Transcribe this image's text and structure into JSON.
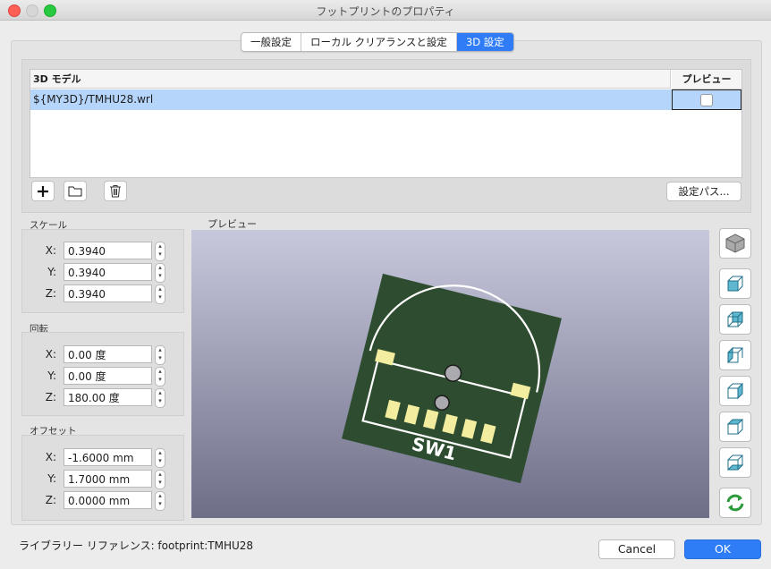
{
  "window": {
    "title": "フットプリントのプロパティ"
  },
  "tabs": [
    {
      "label": "一般設定"
    },
    {
      "label": "ローカル クリアランスと設定"
    },
    {
      "label": "3D 設定"
    }
  ],
  "models": {
    "col_model": "3D モデル",
    "col_preview": "プレビュー",
    "rows": [
      {
        "path": "${MY3D}/TMHU28.wrl",
        "preview": false
      }
    ],
    "config_paths_label": "設定パス..."
  },
  "scale": {
    "label": "スケール",
    "x": "0.3940",
    "y": "0.3940",
    "z": "0.3940"
  },
  "rotation": {
    "label": "回転",
    "x": "0.00 度",
    "y": "0.00 度",
    "z": "180.00 度"
  },
  "offset": {
    "label": "オフセット",
    "x": "-1.6000 mm",
    "y": "1.7000 mm",
    "z": "0.0000 mm"
  },
  "axis_labels": {
    "x": "X:",
    "y": "Y:",
    "z": "Z:"
  },
  "preview": {
    "label": "プレビュー",
    "board_label": "SW1"
  },
  "view_buttons": [
    "cube-iso-icon",
    "view-front-icon",
    "view-back-icon",
    "view-left-icon",
    "view-right-icon",
    "view-top-icon",
    "view-bottom-icon",
    "reload-icon"
  ],
  "footer": {
    "library_ref": "ライブラリー リファレンス:  footprint:TMHU28",
    "cancel_label": "Cancel",
    "ok_label": "OK"
  },
  "colors": {
    "accent": "#2f7cf6",
    "selection": "#b5d5fb",
    "pcb": "#2e4d30",
    "pad": "#f3ee9f"
  }
}
